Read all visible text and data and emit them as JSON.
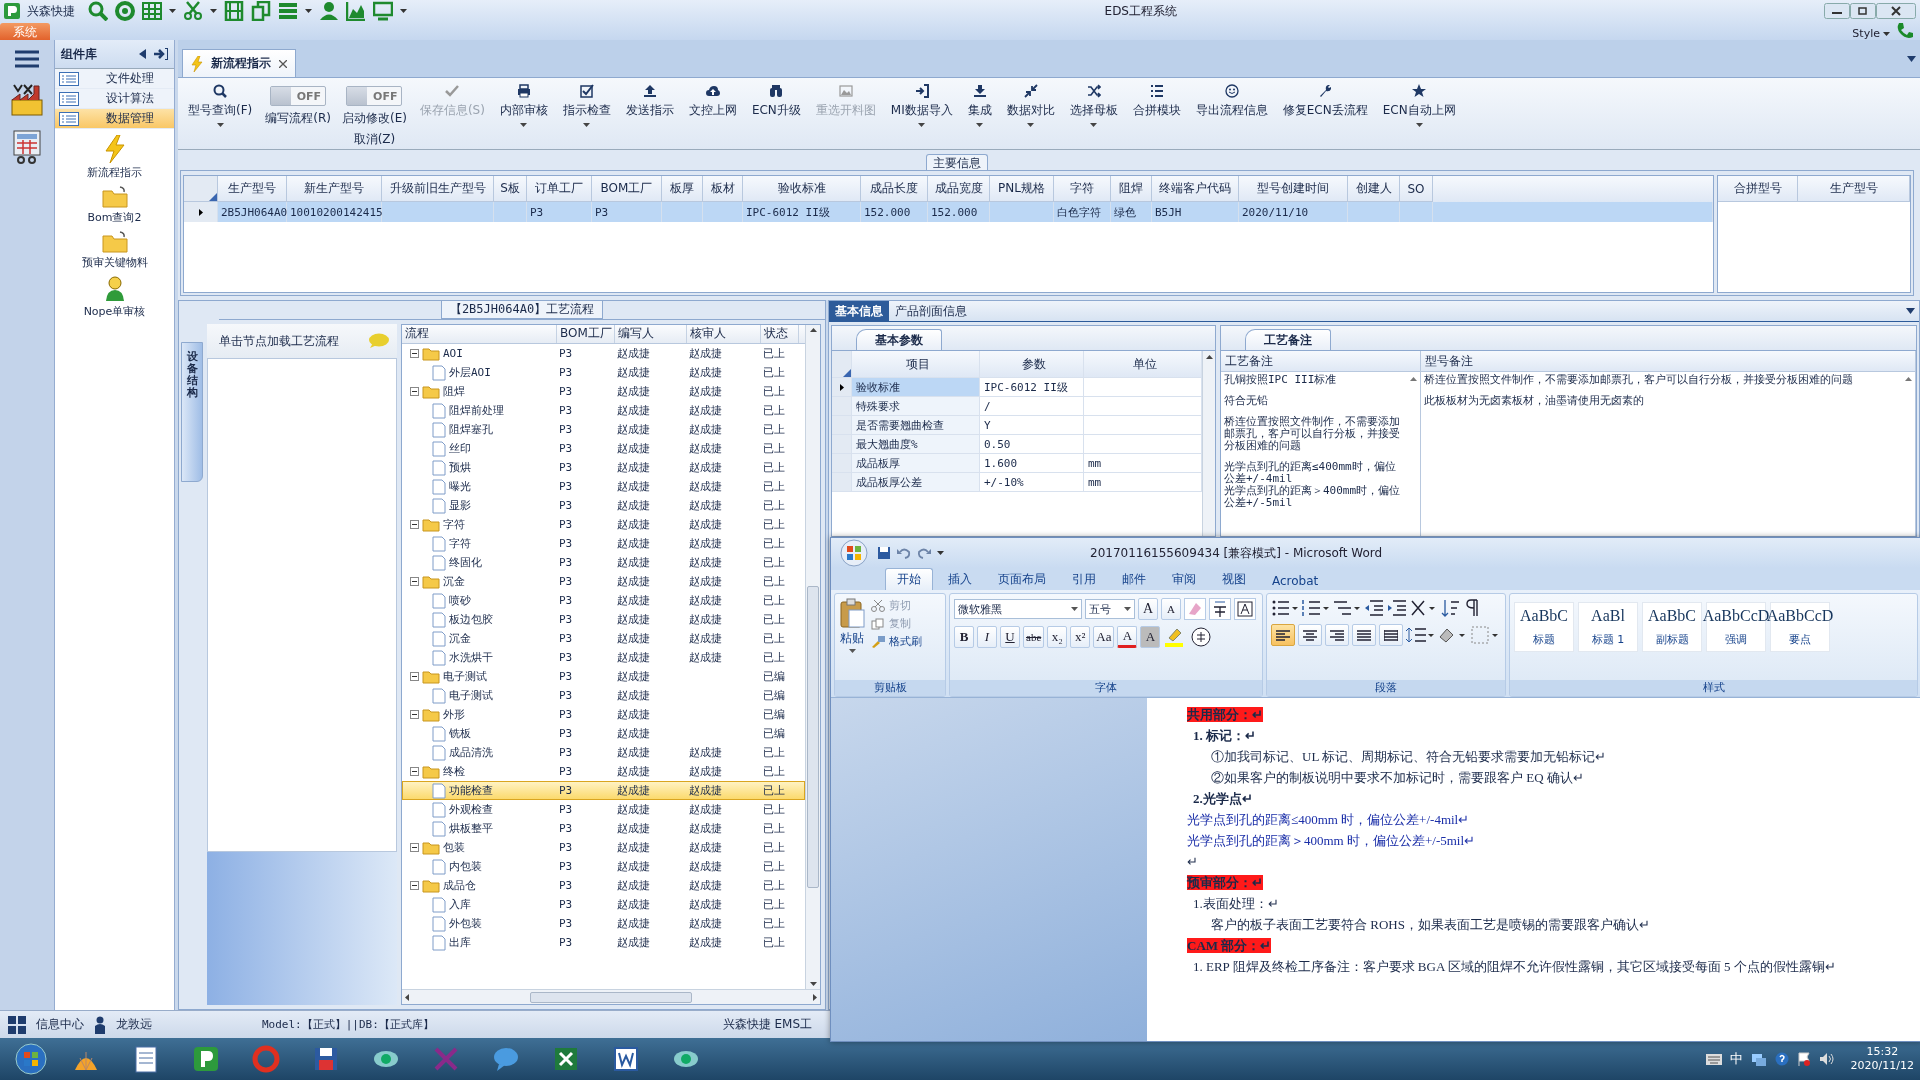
{
  "title_bar": {
    "app_name": "兴森快捷",
    "title": "EDS工程系统",
    "menu_tab": "系统",
    "style_menu": "Style"
  },
  "component_library": {
    "title": "组件库",
    "categories": [
      {
        "label": "文件处理",
        "selected": false
      },
      {
        "label": "设计算法",
        "selected": false
      },
      {
        "label": "数据管理",
        "selected": true
      }
    ],
    "tools": [
      {
        "label": "新流程指示"
      },
      {
        "label": "Bom查询2"
      },
      {
        "label": "预审关键物料"
      },
      {
        "label": "Nope单审核"
      }
    ]
  },
  "document_tabs": [
    {
      "label": "新流程指示",
      "selected": true
    }
  ],
  "ribbon": [
    {
      "kind": "button",
      "label": "型号查询(F)",
      "dropdown": true,
      "disabled": false
    },
    {
      "kind": "toggle",
      "state": "OFF",
      "on": false,
      "label": "编写流程(R)"
    },
    {
      "kind": "toggle",
      "state": "OFF",
      "on": false,
      "label": "启动修改(E)",
      "label2": "取消(Z)"
    },
    {
      "kind": "button",
      "label": "保存信息(S)",
      "dropdown": false,
      "disabled": true
    },
    {
      "kind": "button",
      "label": "内部审核",
      "dropdown": true,
      "disabled": false
    },
    {
      "kind": "button",
      "label": "指示检查",
      "dropdown": true,
      "disabled": false
    },
    {
      "kind": "button",
      "label": "发送指示",
      "dropdown": false,
      "disabled": false
    },
    {
      "kind": "button",
      "label": "文控上网",
      "dropdown": false,
      "disabled": false
    },
    {
      "kind": "button",
      "label": "ECN升级",
      "dropdown": false,
      "disabled": false
    },
    {
      "kind": "button",
      "label": "重选开料图",
      "dropdown": false,
      "disabled": true
    },
    {
      "kind": "button",
      "label": "MI数据导入",
      "dropdown": true,
      "disabled": false
    },
    {
      "kind": "button",
      "label": "集成",
      "dropdown": true,
      "disabled": false
    },
    {
      "kind": "button",
      "label": "数据对比",
      "dropdown": true,
      "disabled": false
    },
    {
      "kind": "button",
      "label": "选择母板",
      "dropdown": true,
      "disabled": false
    },
    {
      "kind": "button",
      "label": "合拼模块",
      "dropdown": false,
      "disabled": false
    },
    {
      "kind": "button",
      "label": "导出流程信息",
      "dropdown": false,
      "disabled": false
    },
    {
      "kind": "button",
      "label": "修复ECN丢流程",
      "dropdown": false,
      "disabled": false
    },
    {
      "kind": "button",
      "label": "ECN自动上网",
      "dropdown": true,
      "disabled": false
    }
  ],
  "main_info": {
    "title": "主要信息",
    "columns": [
      "生产型号",
      "新生产型号",
      "升级前旧生产型号",
      "S板",
      "订单工厂",
      "BOM工厂",
      "板厚",
      "板材",
      "验收标准",
      "成品长度",
      "成品宽度",
      "PNL规格",
      "字符",
      "阻焊",
      "终端客户代码",
      "型号创建时间",
      "创建人",
      "SO"
    ],
    "rows": [
      {
        "selected": true,
        "cells": [
          "2B5JH064A0",
          "10010200142415",
          "",
          "",
          "P3",
          "P3",
          "",
          "",
          "IPC-6012 II级",
          "152.000",
          "152.000",
          "",
          "白色字符",
          "绿色",
          "B5JH",
          "2020/11/10",
          "",
          ""
        ]
      }
    ],
    "merge_table": {
      "columns": [
        "合拼型号",
        "生产型号"
      ]
    }
  },
  "process_flow": {
    "title": "【2B5JH064A0】工艺流程",
    "side_tab": "设备结构",
    "hint": "单击节点加载工艺流程",
    "columns": [
      "流程",
      "BOM工厂",
      "编写人",
      "核审人",
      "状态"
    ],
    "tree": [
      {
        "name": "AOI",
        "bom": "P3",
        "writer": "赵成捷",
        "reviewer": "赵成捷",
        "status": "已上",
        "selected": false,
        "expanded": true,
        "children": [
          {
            "name": "外层AOI",
            "bom": "P3",
            "writer": "赵成捷",
            "reviewer": "赵成捷",
            "status": "已上",
            "selected": false
          }
        ]
      },
      {
        "name": "阻焊",
        "bom": "P3",
        "writer": "赵成捷",
        "reviewer": "赵成捷",
        "status": "已上",
        "selected": false,
        "expanded": true,
        "children": [
          {
            "name": "阻焊前处理",
            "bom": "P3",
            "writer": "赵成捷",
            "reviewer": "赵成捷",
            "status": "已上",
            "selected": false
          },
          {
            "name": "阻焊塞孔",
            "bom": "P3",
            "writer": "赵成捷",
            "reviewer": "赵成捷",
            "status": "已上",
            "selected": false
          },
          {
            "name": "丝印",
            "bom": "P3",
            "writer": "赵成捷",
            "reviewer": "赵成捷",
            "status": "已上",
            "selected": false
          },
          {
            "name": "预烘",
            "bom": "P3",
            "writer": "赵成捷",
            "reviewer": "赵成捷",
            "status": "已上",
            "selected": false
          },
          {
            "name": "曝光",
            "bom": "P3",
            "writer": "赵成捷",
            "reviewer": "赵成捷",
            "status": "已上",
            "selected": false
          },
          {
            "name": "显影",
            "bom": "P3",
            "writer": "赵成捷",
            "reviewer": "赵成捷",
            "status": "已上",
            "selected": false
          }
        ]
      },
      {
        "name": "字符",
        "bom": "P3",
        "writer": "赵成捷",
        "reviewer": "赵成捷",
        "status": "已上",
        "selected": false,
        "expanded": true,
        "children": [
          {
            "name": "字符",
            "bom": "P3",
            "writer": "赵成捷",
            "reviewer": "赵成捷",
            "status": "已上",
            "selected": false
          },
          {
            "name": "终固化",
            "bom": "P3",
            "writer": "赵成捷",
            "reviewer": "赵成捷",
            "status": "已上",
            "selected": false
          }
        ]
      },
      {
        "name": "沉金",
        "bom": "P3",
        "writer": "赵成捷",
        "reviewer": "赵成捷",
        "status": "已上",
        "selected": false,
        "expanded": true,
        "children": [
          {
            "name": "喷砂",
            "bom": "P3",
            "writer": "赵成捷",
            "reviewer": "赵成捷",
            "status": "已上",
            "selected": false
          },
          {
            "name": "板边包胶",
            "bom": "P3",
            "writer": "赵成捷",
            "reviewer": "赵成捷",
            "status": "已上",
            "selected": false
          },
          {
            "name": "沉金",
            "bom": "P3",
            "writer": "赵成捷",
            "reviewer": "赵成捷",
            "status": "已上",
            "selected": false
          },
          {
            "name": "水洗烘干",
            "bom": "P3",
            "writer": "赵成捷",
            "reviewer": "赵成捷",
            "status": "已上",
            "selected": false
          }
        ]
      },
      {
        "name": "电子测试",
        "bom": "P3",
        "writer": "赵成捷",
        "status": "已编",
        "selected": false,
        "expanded": true,
        "children": [
          {
            "name": "电子测试",
            "bom": "P3",
            "writer": "赵成捷",
            "status": "已编",
            "selected": false
          }
        ]
      },
      {
        "name": "外形",
        "bom": "P3",
        "writer": "赵成捷",
        "status": "已编",
        "selected": false,
        "expanded": true,
        "children": [
          {
            "name": "铣板",
            "bom": "P3",
            "writer": "赵成捷",
            "status": "已编",
            "selected": false
          },
          {
            "name": "成品清洗",
            "bom": "P3",
            "writer": "赵成捷",
            "reviewer": "赵成捷",
            "status": "已上",
            "selected": false
          }
        ]
      },
      {
        "name": "终检",
        "bom": "P3",
        "writer": "赵成捷",
        "reviewer": "赵成捷",
        "status": "已上",
        "selected": false,
        "expanded": true,
        "children": [
          {
            "name": "功能检查",
            "bom": "P3",
            "writer": "赵成捷",
            "reviewer": "赵成捷",
            "status": "已上",
            "selected": true
          },
          {
            "name": "外观检查",
            "bom": "P3",
            "writer": "赵成捷",
            "reviewer": "赵成捷",
            "status": "已上",
            "selected": false
          },
          {
            "name": "烘板整平",
            "bom": "P3",
            "writer": "赵成捷",
            "reviewer": "赵成捷",
            "status": "已上",
            "selected": false
          }
        ]
      },
      {
        "name": "包装",
        "bom": "P3",
        "writer": "赵成捷",
        "reviewer": "赵成捷",
        "status": "已上",
        "selected": false,
        "expanded": true,
        "children": [
          {
            "name": "内包装",
            "bom": "P3",
            "writer": "赵成捷",
            "reviewer": "赵成捷",
            "status": "已上",
            "selected": false
          }
        ]
      },
      {
        "name": "成品仓",
        "bom": "P3",
        "writer": "赵成捷",
        "reviewer": "赵成捷",
        "status": "已上",
        "selected": false,
        "expanded": true,
        "children": [
          {
            "name": "入库",
            "bom": "P3",
            "writer": "赵成捷",
            "reviewer": "赵成捷",
            "status": "已上",
            "selected": false
          },
          {
            "name": "外包装",
            "bom": "P3",
            "writer": "赵成捷",
            "reviewer": "赵成捷",
            "status": "已上",
            "selected": false
          },
          {
            "name": "出库",
            "bom": "P3",
            "writer": "赵成捷",
            "reviewer": "赵成捷",
            "status": "已上",
            "selected": false
          }
        ]
      }
    ]
  },
  "info_tabs": [
    {
      "label": "基本信息",
      "selected": true
    },
    {
      "label": "产品剖面信息",
      "selected": false
    }
  ],
  "basic_params": {
    "tab": "基本参数",
    "columns": [
      "项目",
      "参数",
      "单位"
    ],
    "rows": [
      {
        "item": "验收标准",
        "value": "IPC-6012 II级",
        "unit": "",
        "selected": true
      },
      {
        "item": "特殊要求",
        "value": "/",
        "unit": "",
        "selected": false
      },
      {
        "item": "是否需要翘曲检查",
        "value": "Y",
        "unit": "",
        "selected": false
      },
      {
        "item": "最大翘曲度%",
        "value": "0.50",
        "unit": "",
        "selected": false
      },
      {
        "item": "成品板厚",
        "value": "1.600",
        "unit": "mm",
        "selected": false
      },
      {
        "item": "成品板厚公差",
        "value": "+/-10%",
        "unit": "mm",
        "selected": false
      }
    ]
  },
  "process_notes": {
    "tab": "工艺备注",
    "columns": [
      "工艺备注",
      "型号备注"
    ],
    "process_remarks": [
      "孔铜按照IPC III标准",
      "符合无铅",
      "桥连位置按照文件制作，不需要添加邮票孔，客户可以自行分板，并接受分板困难的问题",
      "光学点到孔的距离≤400mm时，偏位公差+/-4mil\n光学点到孔的距离＞400mm时，偏位公差+/-5mil"
    ],
    "model_remarks": [
      "桥连位置按照文件制作，不需要添加邮票孔，客户可以自行分板，并接受分板困难的问题",
      "此板板材为无卤素板材，油墨请使用无卤素的"
    ]
  },
  "word_window": {
    "title": "20170116155609434 [兼容模式] - Microsoft Word",
    "tabs": [
      {
        "label": "开始",
        "selected": true
      },
      {
        "label": "插入",
        "selected": false
      },
      {
        "label": "页面布局",
        "selected": false
      },
      {
        "label": "引用",
        "selected": false
      },
      {
        "label": "邮件",
        "selected": false
      },
      {
        "label": "审阅",
        "selected": false
      },
      {
        "label": "视图",
        "selected": false
      },
      {
        "label": "Acrobat",
        "selected": false
      }
    ],
    "clipboard": {
      "group": "剪贴板",
      "paste": "粘贴",
      "actions": [
        {
          "label": "剪切",
          "disabled": true
        },
        {
          "label": "复制",
          "disabled": true
        },
        {
          "label": "格式刷",
          "disabled": false
        }
      ]
    },
    "font": {
      "group": "字体",
      "name": "微软雅黑",
      "size": "五号",
      "size_buttons": [
        "A",
        "A"
      ],
      "format_buttons": [
        "B",
        "I",
        "U",
        "abe",
        "x₂",
        "x²",
        "Aa",
        "A",
        "A"
      ]
    },
    "paragraph": {
      "group": "段落",
      "align_buttons": [
        {
          "selected": true
        },
        {
          "selected": false
        },
        {
          "selected": false
        },
        {
          "selected": false
        },
        {
          "selected": false
        }
      ]
    },
    "styles": {
      "group": "样式",
      "items": [
        {
          "sample": "AaBbC",
          "label": "标题"
        },
        {
          "sample": "AaBl",
          "label": "标题 1"
        },
        {
          "sample": "AaBbC",
          "label": "副标题"
        },
        {
          "sample": "AaBbCcD",
          "label": "强调"
        },
        {
          "sample": "AaBbCcD",
          "label": "要点"
        }
      ]
    },
    "document": [
      {
        "kind": "highlight",
        "text": "共用部分：↵"
      },
      {
        "kind": "heading",
        "text": "1. 标记：↵"
      },
      {
        "kind": "subitem",
        "text": "①加我司标记、UL 标记、周期标记、符合无铅要求需要加无铅标记↵"
      },
      {
        "kind": "subitem",
        "text": "②如果客户的制板说明中要求不加标记时，需要跟客户 EQ 确认↵"
      },
      {
        "kind": "heading",
        "text": "2.光学点↵"
      },
      {
        "kind": "blue",
        "text": "光学点到孔的距离≤400mm 时，偏位公差+/-4mil↵"
      },
      {
        "kind": "blue",
        "text": "光学点到孔的距离＞400mm 时，偏位公差+/-5mil↵"
      },
      {
        "kind": "empty",
        "text": "↵"
      },
      {
        "kind": "highlight",
        "text": "预审部分：↵"
      },
      {
        "kind": "item",
        "text": "1.表面处理：↵"
      },
      {
        "kind": "subitem",
        "text": "客户的板子表面工艺要符合 ROHS，如果表面工艺是喷锡的需要跟客户确认↵"
      },
      {
        "kind": "highlight",
        "text": "CAM 部分：↵"
      },
      {
        "kind": "item",
        "text": "1. ERP 阻焊及终检工序备注：客户要求 BGA 区域的阻焊不允许假性露铜，其它区域接受每面 5 个点的假性露铜↵"
      }
    ]
  },
  "status_bar": {
    "items": [
      "信息中心",
      "龙敦远",
      "Model:【正式】||DB:【正式库】",
      "兴森快捷 EMS工"
    ]
  },
  "taskbar": {
    "ime": "中",
    "time": "15:32",
    "date": "2020/11/12"
  }
}
